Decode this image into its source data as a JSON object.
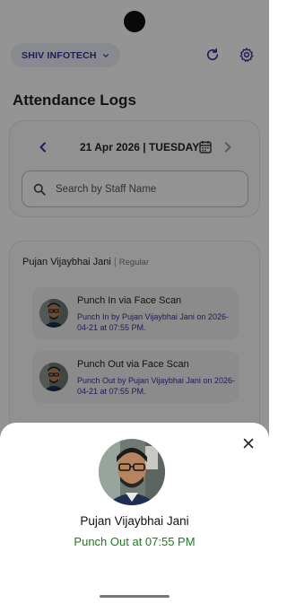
{
  "header": {
    "company_name": "SHIV INFOTECH",
    "icons": [
      "chevron-down-icon",
      "refresh-icon",
      "settings-icon"
    ]
  },
  "page": {
    "title": "Attendance Logs"
  },
  "date_selector": {
    "date_text": "21 Apr 2026 | TUESDAY",
    "prev_icon": "chevron-left-icon",
    "next_icon": "chevron-right-icon",
    "calendar_icon": "calendar-icon"
  },
  "search": {
    "placeholder": "Search by Staff Name",
    "value": ""
  },
  "staff": {
    "name": "Pujan Vijaybhai Jani",
    "separator": "|",
    "type": "Regular"
  },
  "logs": [
    {
      "title": "Punch In via Face Scan",
      "description": "Punch In by Pujan Vijaybhai Jani on 2026-04-21 at 07:55 PM."
    },
    {
      "title": "Punch Out via Face Scan",
      "description": "Punch Out by Pujan Vijaybhai Jani on 2026-04-21 at 07:55 PM."
    }
  ],
  "sheet": {
    "name": "Pujan Vijaybhai Jani",
    "status": "Punch Out at 07:55 PM",
    "close_icon": "close-icon"
  },
  "colors": {
    "accent": "#3a2f9a",
    "success": "#1f7a1f",
    "scrim": "#000000"
  }
}
